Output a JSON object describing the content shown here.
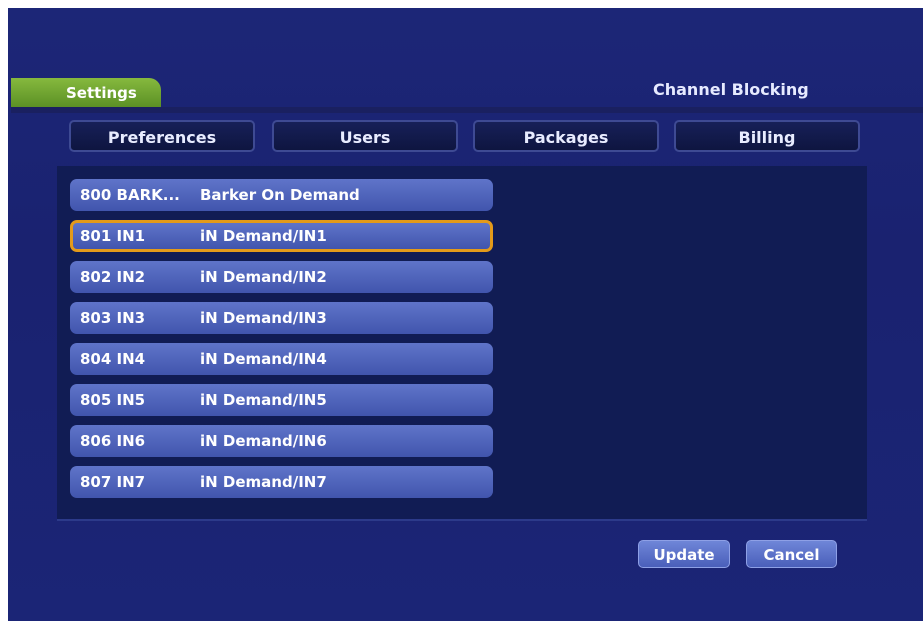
{
  "header": {
    "settings_tab": "Settings",
    "page_title": "Channel Blocking"
  },
  "tabs": [
    {
      "label": "Preferences"
    },
    {
      "label": "Users"
    },
    {
      "label": "Packages"
    },
    {
      "label": "Billing"
    }
  ],
  "channels": [
    {
      "number": "800 BARK...",
      "name": "Barker On Demand",
      "selected": false
    },
    {
      "number": "801 IN1",
      "name": "iN Demand/IN1",
      "selected": true
    },
    {
      "number": "802 IN2",
      "name": "iN Demand/IN2",
      "selected": false
    },
    {
      "number": "803 IN3",
      "name": "iN Demand/IN3",
      "selected": false
    },
    {
      "number": "804 IN4",
      "name": "iN Demand/IN4",
      "selected": false
    },
    {
      "number": "805 IN5",
      "name": "iN Demand/IN5",
      "selected": false
    },
    {
      "number": "806 IN6",
      "name": "iN Demand/IN6",
      "selected": false
    },
    {
      "number": "807 IN7",
      "name": "iN Demand/IN7",
      "selected": false
    }
  ],
  "actions": {
    "update_label": "Update",
    "cancel_label": "Cancel"
  },
  "colors": {
    "background": "#1b2576",
    "settings_tab": "#6a9e2c",
    "row": "#4f64bb",
    "selected_outline": "#e39a1a"
  }
}
